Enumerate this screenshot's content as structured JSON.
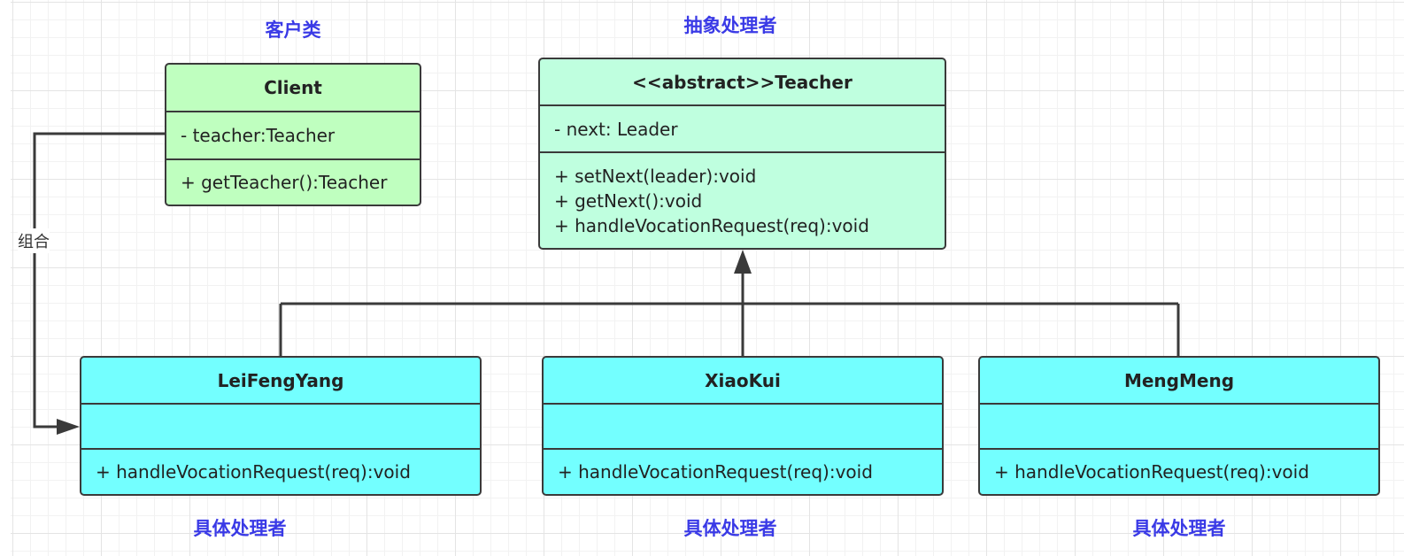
{
  "captions": {
    "client": "客户类",
    "abstract_handler": "抽象处理者",
    "concrete_1": "具体处理者",
    "concrete_2": "具体处理者",
    "concrete_3": "具体处理者"
  },
  "edge_labels": {
    "composition": "组合"
  },
  "classes": {
    "client": {
      "name": "Client",
      "attributes": [
        "- teacher:Teacher"
      ],
      "operations": [
        "+ getTeacher():Teacher"
      ]
    },
    "teacher": {
      "name": "<<abstract>>Teacher",
      "attributes": [
        "- next: Leader"
      ],
      "operations": [
        "+ setNext(leader):void",
        "+ getNext():void",
        "+ handleVocationRequest(req):void"
      ]
    },
    "leifengyang": {
      "name": "LeiFengYang",
      "attributes": [],
      "operations": [
        "+ handleVocationRequest(req):void"
      ]
    },
    "xiaokui": {
      "name": "XiaoKui",
      "attributes": [],
      "operations": [
        "+ handleVocationRequest(req):void"
      ]
    },
    "mengmeng": {
      "name": "MengMeng",
      "attributes": [],
      "operations": [
        "+ handleVocationRequest(req):void"
      ]
    }
  },
  "colors": {
    "client_fill": "#bfffbf",
    "abstract_fill": "#bfffdf",
    "concrete_fill": "#73ffff",
    "caption_text": "#3a3ae6",
    "stroke": "#3a3a3a"
  }
}
